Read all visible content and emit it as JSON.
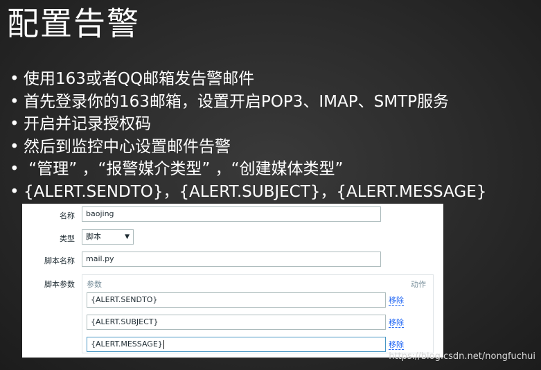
{
  "slide": {
    "title": "配置告警",
    "bullets": [
      "使用163或者QQ邮箱发告警邮件",
      "首先登录你的163邮箱，设置开启POP3、IMAP、SMTP服务",
      "开启并记录授权码",
      "然后到监控中心设置邮件告警",
      " “管理” ，“报警媒介类型” ，“创建媒体类型”",
      "{ALERT.SENDTO}，{ALERT.SUBJECT}，{ALERT.MESSAGE}"
    ]
  },
  "form": {
    "name_label": "名称",
    "name_value": "baojing",
    "type_label": "类型",
    "type_selected": "脚本",
    "script_name_label": "脚本名称",
    "script_name_value": "mail.py",
    "script_params_label": "脚本参数",
    "params_header": "参数",
    "action_header": "动作",
    "params": [
      {
        "value": "{ALERT.SENDTO}",
        "remove_label": "移除"
      },
      {
        "value": "{ALERT.SUBJECT}",
        "remove_label": "移除"
      },
      {
        "value": "{ALERT.MESSAGE}",
        "remove_label": "移除"
      }
    ]
  },
  "watermark": "https://blog.csdn.net/nongfuchui"
}
